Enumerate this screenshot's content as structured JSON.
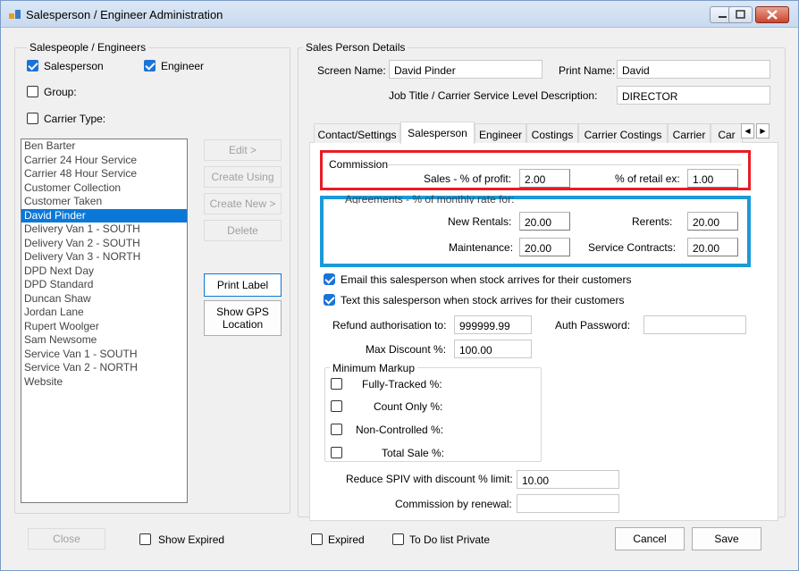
{
  "window": {
    "title": "Salesperson / Engineer Administration"
  },
  "left": {
    "group_label": "Salespeople / Engineers",
    "salesperson_label": "Salesperson",
    "engineer_label": "Engineer",
    "group_label_cb": "Group:",
    "carrier_type_label": "Carrier Type:",
    "list_items": [
      "Ben Barter",
      "Carrier 24 Hour Service",
      "Carrier 48 Hour Service",
      "Customer Collection",
      "Customer Taken",
      "David Pinder",
      "Delivery Van 1 - SOUTH",
      "Delivery Van 2 - SOUTH",
      "Delivery Van 3 - NORTH",
      "DPD Next Day",
      "DPD Standard",
      "Duncan Shaw",
      "Jordan Lane",
      "Rupert Woolger",
      "Sam Newsome",
      "Service Van 1 - SOUTH",
      "Service Van 2 - NORTH",
      "Website"
    ],
    "selected_index": 5,
    "buttons": {
      "edit": "Edit >",
      "create_using": "Create Using",
      "create_new": "Create New >",
      "delete": "Delete",
      "print_label": "Print Label",
      "show_gps": "Show GPS Location"
    },
    "close": "Close",
    "show_expired": "Show Expired"
  },
  "details": {
    "group_label": "Sales Person Details",
    "screen_name_label": "Screen Name:",
    "screen_name": "David Pinder",
    "print_name_label": "Print Name:",
    "print_name": "David",
    "job_title_label": "Job Title / Carrier Service Level Description:",
    "job_title": "DIRECTOR"
  },
  "tabs": [
    "Contact/Settings",
    "Salesperson",
    "Engineer",
    "Costings",
    "Carrier Costings",
    "Carrier",
    "Car"
  ],
  "active_tab": 1,
  "commission": {
    "group_label": "Commission",
    "sales_profit_label": "Sales - % of profit:",
    "sales_profit": "2.00",
    "retail_ex_label": "% of retail ex:",
    "retail_ex": "1.00"
  },
  "agreements": {
    "group_label": "Agreements - % of monthly rate for:",
    "new_rentals_label": "New Rentals:",
    "new_rentals": "20.00",
    "rerents_label": "Rerents:",
    "rerents": "20.00",
    "maintenance_label": "Maintenance:",
    "maintenance": "20.00",
    "service_contracts_label": "Service Contracts:",
    "service_contracts": "20.00"
  },
  "notify": {
    "email_label": "Email this salesperson when stock arrives for their customers",
    "text_label": "Text this salesperson when stock arrives for their customers"
  },
  "limits": {
    "refund_label": "Refund authorisation to:",
    "refund": "999999.99",
    "auth_password_label": "Auth Password:",
    "auth_password": "",
    "max_discount_label": "Max Discount %:",
    "max_discount": "100.00"
  },
  "min_markup": {
    "group_label": "Minimum Markup",
    "fully_tracked": "Fully-Tracked %:",
    "count_only": "Count Only %:",
    "non_controlled": "Non-Controlled %:",
    "total_sale": "Total Sale %:"
  },
  "spiv": {
    "reduce_label": "Reduce SPIV with discount % limit:",
    "reduce": "10.00",
    "renewal_label": "Commission by renewal:",
    "renewal": ""
  },
  "footer": {
    "expired": "Expired",
    "todo_private": "To Do list Private",
    "cancel": "Cancel",
    "save": "Save"
  },
  "colors": {
    "selection": "#0a78d7",
    "highlight_red": "#e81c24",
    "highlight_blue": "#1a9ad9",
    "checkbox_checked": "#1a73d9"
  }
}
